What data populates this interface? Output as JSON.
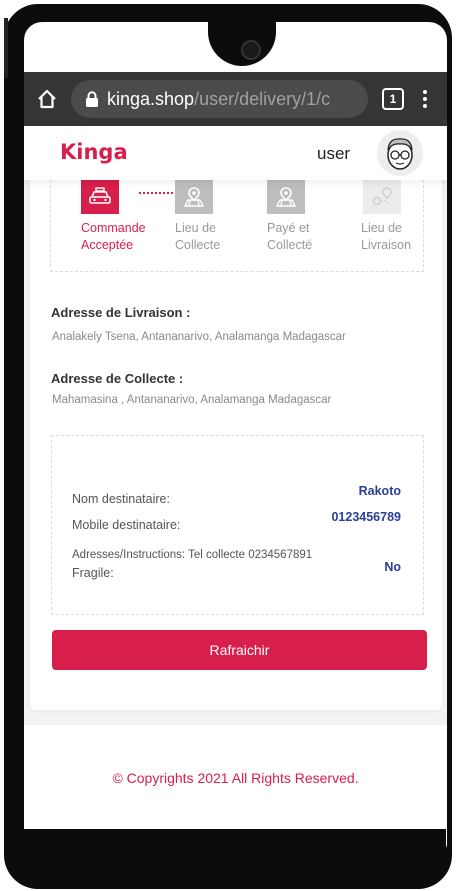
{
  "browser": {
    "url_host": "kinga.shop",
    "url_path": "/user/delivery/1/c",
    "tab_count": "1"
  },
  "header": {
    "logo": "Kinga",
    "user_label": "user"
  },
  "steps": [
    {
      "line1": "Commande",
      "line2": "Acceptée",
      "state": "active"
    },
    {
      "line1": "Lieu de",
      "line2": "Collecte",
      "state": "inactive"
    },
    {
      "line1": "Payé et",
      "line2": "Collecté",
      "state": "inactive"
    },
    {
      "line1": "Lieu de",
      "line2": "Livraison",
      "state": "faded"
    }
  ],
  "delivery_address": {
    "title": "Adresse de Livraison :",
    "value": "Analakely Tsena, Antananarivo, Analamanga Madagascar"
  },
  "pickup_address": {
    "title": "Adresse de Collecte :",
    "value": "Mahamasina , Antananarivo, Analamanga Madagascar"
  },
  "recipient": {
    "name_label": "Nom destinataire:",
    "name_value": "Rakoto",
    "mobile_label": "Mobile destinataire:",
    "mobile_value": "0123456789",
    "instructions_label": "Adresses/Instructions: Tel collecte 0234567891",
    "fragile_label": "Fragile:",
    "fragile_value": "No"
  },
  "actions": {
    "refresh_label": "Rafraichir"
  },
  "footer": {
    "copyright": "© Copyrights 2021 All Rights Reserved."
  },
  "colors": {
    "brand": "#d81e4b",
    "value_text": "#2c3e97"
  }
}
